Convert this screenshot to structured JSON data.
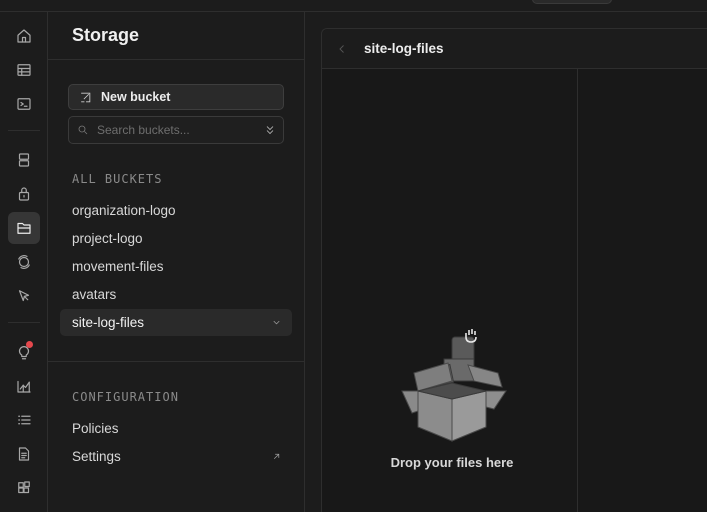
{
  "sidebar": {
    "title": "Storage",
    "new_bucket_label": "New bucket",
    "search_placeholder": "Search buckets...",
    "all_buckets_label": "ALL BUCKETS",
    "buckets": [
      {
        "label": "organization-logo"
      },
      {
        "label": "project-logo"
      },
      {
        "label": "movement-files"
      },
      {
        "label": "avatars"
      },
      {
        "label": "site-log-files",
        "selected": true
      }
    ],
    "configuration_label": "CONFIGURATION",
    "config_items": [
      {
        "label": "Policies"
      },
      {
        "label": "Settings"
      }
    ]
  },
  "rail": {
    "icons": [
      "home-icon",
      "table-editor-icon",
      "sql-editor-icon",
      "database-icon",
      "auth-icon",
      "storage-icon",
      "realtime-icon",
      "edge-functions-icon",
      "advisors-icon",
      "reports-icon",
      "logs-icon",
      "docs-icon",
      "integrations-icon"
    ],
    "active": "storage-icon"
  },
  "panel": {
    "title": "site-log-files",
    "drop_text": "Drop your files here"
  },
  "colors": {
    "background": "#1c1c1c",
    "panel": "#181818",
    "border": "#2e2e2e",
    "notification": "#e5484d"
  }
}
